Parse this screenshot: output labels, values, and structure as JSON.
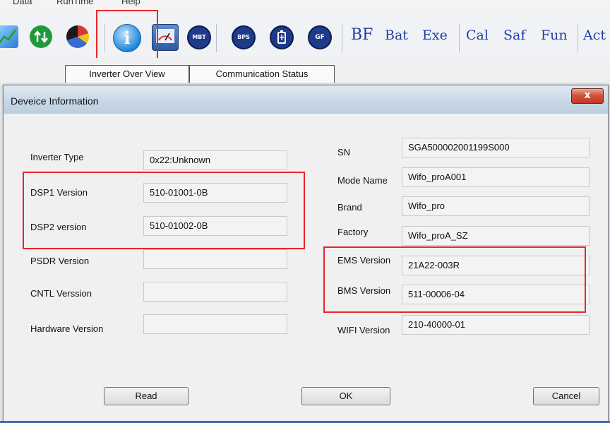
{
  "menu": {
    "items": [
      "Data",
      "RunTime",
      "Help"
    ]
  },
  "toolbar": {
    "icon_buttons": [
      {
        "name": "chart-icon",
        "label": "",
        "color": "#2b7bd6"
      },
      {
        "name": "updown-icon",
        "label": "",
        "color": "#1f9a3b"
      },
      {
        "name": "pie-icon",
        "label": "",
        "color": "#3a6bd0"
      },
      {
        "name": "info-icon",
        "label": "i",
        "color": "#1d86d8"
      },
      {
        "name": "meter-icon",
        "label": "",
        "color": "#4a78b8"
      },
      {
        "name": "mbt-icon",
        "label": "MBT",
        "color": "#1e3a8a"
      },
      {
        "name": "bps-icon",
        "label": "BPS",
        "color": "#1e3a8a"
      },
      {
        "name": "battery-icon",
        "label": "",
        "color": "#1e3a8a"
      },
      {
        "name": "gf-icon",
        "label": "GF",
        "color": "#1e3a8a"
      }
    ],
    "text_buttons": [
      "BF",
      "Bat",
      "Exe",
      "Cal",
      "Saf",
      "Fun",
      "Act"
    ]
  },
  "tabs": [
    "Inverter Over View",
    "Communication Status"
  ],
  "dialog": {
    "title": "Deveice Information",
    "close_label": "x",
    "left_fields": [
      {
        "label": "Inverter Type",
        "value": "0x22:Unknown"
      },
      {
        "label": "DSP1 Version",
        "value": "510-01001-0B"
      },
      {
        "label": "DSP2 version",
        "value": "510-01002-0B"
      },
      {
        "label": "PSDR Version",
        "value": ""
      },
      {
        "label": "CNTL Verssion",
        "value": ""
      },
      {
        "label": "Hardware Version",
        "value": ""
      }
    ],
    "right_fields": [
      {
        "label": "SN",
        "value": "SGA500002001199S000"
      },
      {
        "label": "Mode Name",
        "value": "Wifo_proA001"
      },
      {
        "label": "Brand",
        "value": "Wifo_pro"
      },
      {
        "label": "Factory",
        "value": "Wifo_proA_SZ"
      },
      {
        "label": "EMS Version",
        "value": "21A22-003R"
      },
      {
        "label": "BMS Version",
        "value": "511-00006-04"
      },
      {
        "label": "WIFI Version",
        "value": "210-40000-01"
      }
    ],
    "buttons": {
      "read": "Read",
      "ok": "OK",
      "cancel": "Cancel"
    }
  },
  "colors": {
    "highlight": "#e8262b",
    "accent": "#1e3ea8"
  }
}
